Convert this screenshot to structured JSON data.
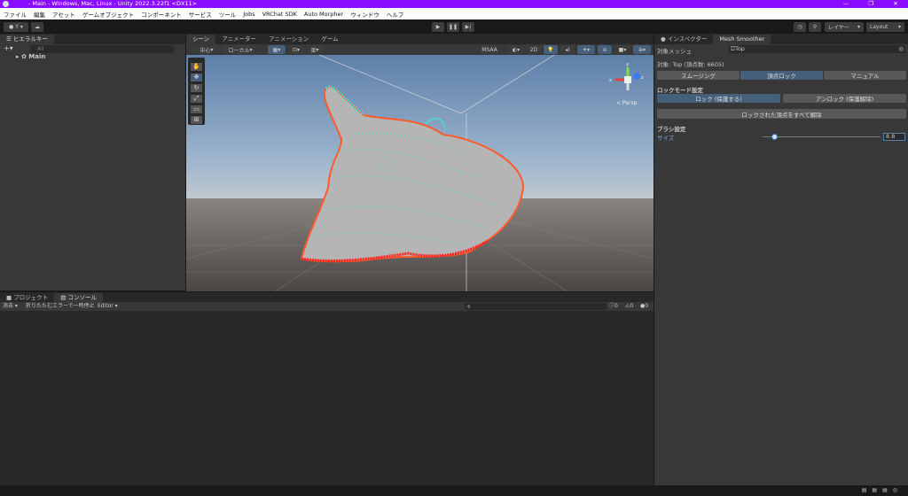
{
  "window": {
    "title": "- Main - Windows, Mac, Linux - Unity 2022.3.22f1 <DX11>",
    "controls": [
      "—",
      "❐",
      "✕"
    ]
  },
  "menu": [
    "ファイル",
    "編集",
    "アセット",
    "ゲームオブジェクト",
    "コンポーネント",
    "サービス",
    "ツール",
    "Jobs",
    "VRChat SDK",
    "Auto Morpher",
    "ウィンドウ",
    "ヘルプ"
  ],
  "toolbar": {
    "account": "Y ▾",
    "layers": "レイヤー",
    "layout": "Layout"
  },
  "hierarchy": {
    "tab": "ヒエラルキー",
    "search_placeholder": "All",
    "scene": "Main",
    "add": "+▾"
  },
  "scene": {
    "tabs": [
      "シーン",
      "アニメーター",
      "アニメーション",
      "ゲーム"
    ],
    "pivot": "中心",
    "space": "ローカル",
    "msaa": "MSAA",
    "mode2d": "2D",
    "persp": "< Persp",
    "axes": {
      "x": "x",
      "y": "y",
      "z": "z"
    }
  },
  "console": {
    "tabs": [
      "プロジェクト",
      "コンソール"
    ],
    "clear": "消去",
    "collapse": "折りたたむ",
    "error_pause": "エラーで一時停止",
    "editor": "Editor ▾",
    "counts": [
      "0",
      "0",
      "0"
    ]
  },
  "inspector": {
    "tabs": [
      "インスペクター",
      "Mesh Smoother"
    ],
    "target_label": "対象メッシュ",
    "target_value": "Top",
    "info": "対象: Top (頂点数: 6605)",
    "mode_tabs": [
      "スムージング",
      "頂点ロック",
      "マニュアル"
    ],
    "lock_heading": "ロックモード設定",
    "lock": "ロック (保護する)",
    "unlock": "アンロック (保護解除)",
    "unlock_all": "ロックされた頂点をすべて解除",
    "brush_heading": "ブラシ設定",
    "size_label": "サイズ",
    "size_value": "8.8",
    "size_fraction": 0.1
  }
}
